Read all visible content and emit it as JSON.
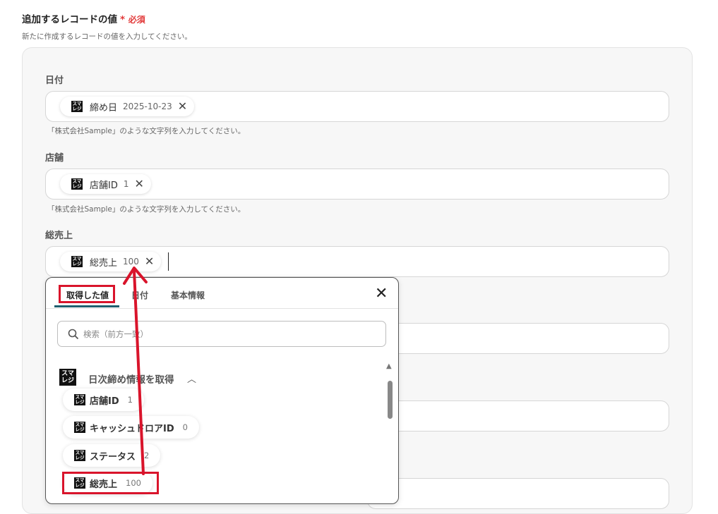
{
  "section": {
    "title": "追加するレコードの値",
    "required_mark": "*",
    "required_text": "必須",
    "description": "新たに作成するレコードの値を入力してください。"
  },
  "fields": [
    {
      "label": "日付",
      "chip_name": "締め日",
      "chip_value": "2025-10-23",
      "hint": "「株式会社Sample」のような文字列を入力してください。"
    },
    {
      "label": "店舗",
      "chip_name": "店舗ID",
      "chip_value": "1",
      "hint": "「株式会社Sample」のような文字列を入力してください。"
    },
    {
      "label": "総売上",
      "chip_name": "総売上",
      "chip_value": "100"
    }
  ],
  "logo_text": "スマレジ",
  "dropdown": {
    "tabs": [
      "取得した値",
      "日付",
      "基本情報"
    ],
    "active_tab": 0,
    "search_placeholder": "検索（前方一致）",
    "group_title": "日次締め情報を取得",
    "options": [
      {
        "name": "店舗ID",
        "value": "1"
      },
      {
        "name": "キャッシュドロアID",
        "value": "0"
      },
      {
        "name": "ステータス",
        "value": "2"
      },
      {
        "name": "総売上",
        "value": "100"
      }
    ]
  },
  "colors": {
    "accent": "#d9142b",
    "tab_underline": "#1f5f6f",
    "required": "#e23a3a"
  }
}
